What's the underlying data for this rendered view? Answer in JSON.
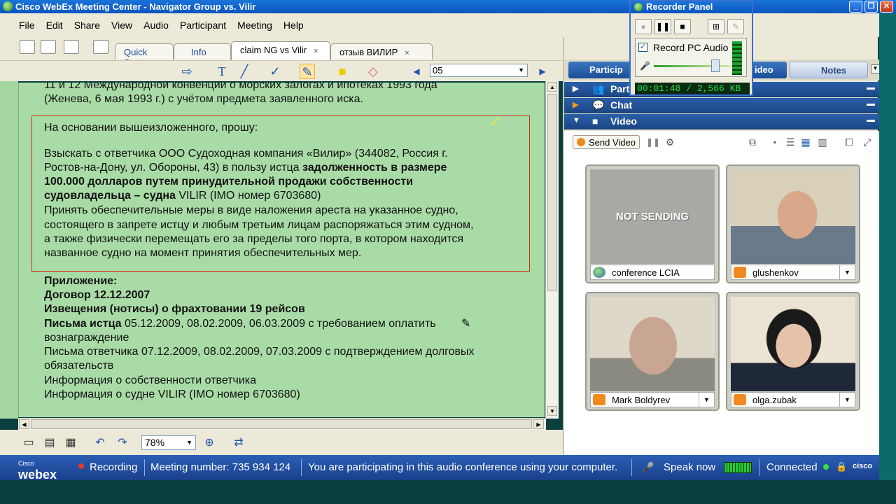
{
  "window": {
    "title": "Cisco WebEx Meeting Center - Navigator Group vs. Vilir"
  },
  "menu": [
    "File",
    "Edit",
    "Share",
    "View",
    "Audio",
    "Participant",
    "Meeting",
    "Help"
  ],
  "tabs": [
    {
      "label": "Quick Start"
    },
    {
      "label": "Info"
    },
    {
      "label": "claim NG vs Vilir",
      "close": "×"
    },
    {
      "label": "отзыв ВИЛИР",
      "close": "×"
    }
  ],
  "page_select": {
    "value": "05"
  },
  "document": {
    "top_line1": "11 и 12 Международной конвенции о морских залогах и ипотеках 1993 года",
    "top_line2": "(Женева, 6 мая 1993 г.) с учётом предмета заявленного иска.",
    "request_intro": "На основании вышеизложенного, прошу:",
    "p1_l1": "Взыскать с ответчика ООО Судоходная компания «Вилир» (344082, Россия г.",
    "p1_l2_a": "Ростов-на-Дону, ул. Обороны, 43) в пользу истца ",
    "p1_l2_b": "задолженность в размере",
    "p1_l3": "100.000 долларов путем принудительной продажи собственности",
    "p1_l4_a": "судовладельца – судна ",
    "p1_l4_b": "VILIR (IMO номер 6703680)",
    "p2_l1": "Принять обеспечительные меры в виде наложения ареста на указанное судно,",
    "p2_l2": "состоящего в запрете истцу и любым третьим лицам распоряжаться этим судном,",
    "p2_l3": "а также физически перемещать его за пределы того порта, в котором находится",
    "p2_l4": "названное судно на момент принятия обеспечительных мер.",
    "appendix_title": "Приложение:",
    "app1": "Договор 12.12.2007",
    "app2": "Извещения (нотисы) о фрахтовании 19 рейсов",
    "app3_a": "Письма истца ",
    "app3_b": "05.12.2009, 08.02.2009, 06.03.2009 с требованием оплатить",
    "app3_c": "вознаграждение",
    "app4_a": "Письма ответчика 07.12.2009, 08.02.2009, 07.03.2009 с подтверждением долговых",
    "app4_b": "обязательств",
    "app5": "Информация о собственности ответчика",
    "app6": "Информация о судне VILIR (IMO номер 6703680)"
  },
  "zoom": {
    "value": "78%"
  },
  "panel": {
    "participants_tab": "Particip",
    "video_tab": "ideo",
    "notes_tab": "Notes",
    "sections": {
      "participants": "Part",
      "chat": "Chat",
      "video": "Video"
    },
    "send_video": "Send Video",
    "tiles": [
      {
        "name": "conference LCIA",
        "state": "NOT SENDING"
      },
      {
        "name": "glushenkov"
      },
      {
        "name": "Mark Boldyrev"
      },
      {
        "name": "olga.zubak"
      }
    ]
  },
  "recorder": {
    "title": "Recorder Panel",
    "record_pc_audio": "Record PC Audio",
    "timer": "00:01:48 / 2,566 KB"
  },
  "status": {
    "logo_top": "Cisco",
    "logo": "webex",
    "recording": "Recording",
    "meeting_number": "Meeting number: 735 934 124",
    "audio_msg": "You are participating in this audio conference using your computer.",
    "speak_now": "Speak now",
    "connected": "Connected",
    "cisco": "cisco"
  },
  "colors": {
    "doc_bg": "#a9dba6",
    "title_bar": "#0a55c0",
    "status_bar": "#1a3f8c",
    "red_box": "#d42b1a"
  }
}
